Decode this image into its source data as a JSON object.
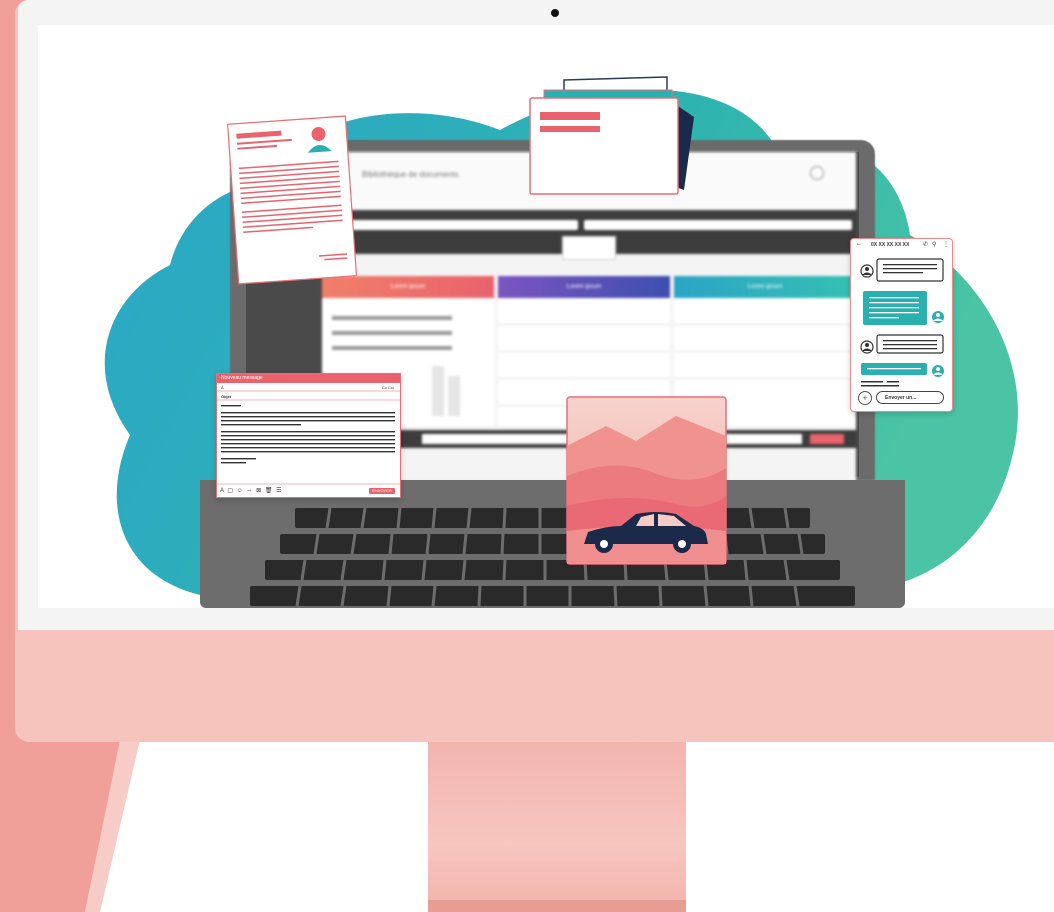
{
  "app": {
    "title": "Bibliothèque de documents"
  },
  "kanban": {
    "columns": [
      {
        "header": "Lorem ipsum",
        "color": "#ef6b64"
      },
      {
        "header": "Lorem ipsum",
        "color": "#6f4fb7"
      },
      {
        "header": "Lorem ipsum",
        "color": "#2fb2b8"
      }
    ]
  },
  "email": {
    "header": "Nouveau message",
    "to_label": "À",
    "cc_label": "Cc Cci",
    "subject_label": "Objet",
    "send_label": "ENVOYER",
    "toolbar_icons": "A ▢ ☺ ⇔ ⊠ 🗑 ☰"
  },
  "chat": {
    "title": "0X XX XX XX XX",
    "input_placeholder": "Envoyer un..."
  },
  "colors": {
    "accent": "#e9626c",
    "teal": "#2bb0b1",
    "imac_pink": "#f6c3bd"
  }
}
